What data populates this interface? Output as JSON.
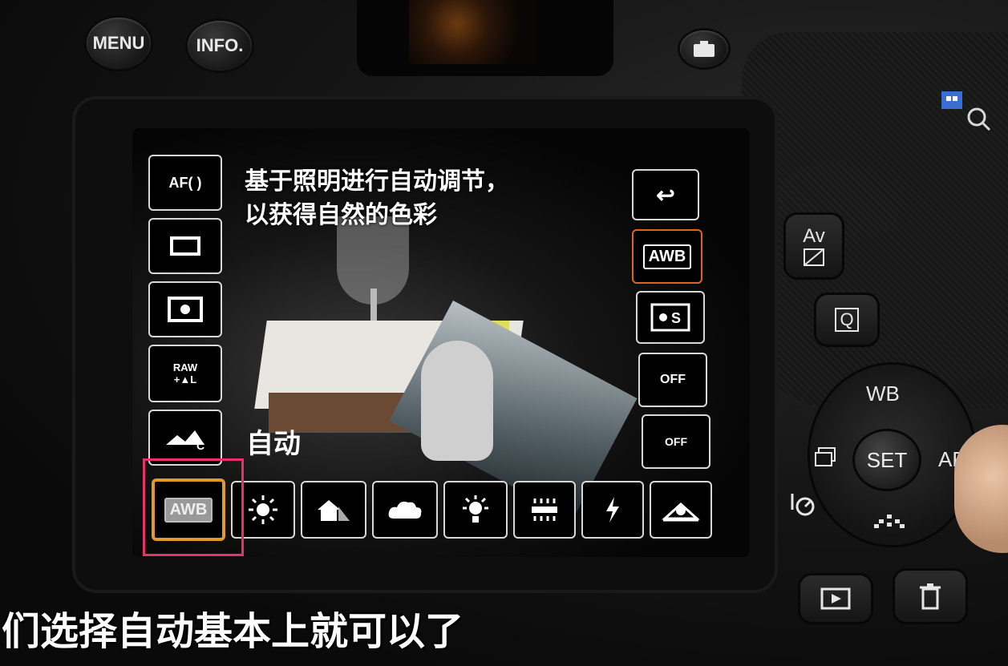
{
  "camera": {
    "menu_label": "MENU",
    "info_label": "INFO.",
    "wb_label": "WB",
    "set_label": "SET",
    "af_label": "AF",
    "av_label": "Av",
    "q_label": "Q"
  },
  "lcd": {
    "message_line1": "基于照明进行自动调节，",
    "message_line2": "以获得自然的色彩",
    "mode_label": "自动",
    "left_menu": [
      {
        "label": "AF( )",
        "icon": "af-area-icon"
      },
      {
        "label": "",
        "icon": "drive-mode-icon"
      },
      {
        "label": "",
        "icon": "metering-icon"
      },
      {
        "label": "RAW +▲L",
        "icon": "image-quality-icon"
      },
      {
        "label": "",
        "icon": "picture-style-icon"
      }
    ],
    "right_menu": [
      {
        "label": "↩",
        "icon": "return-icon"
      },
      {
        "label": "AWB",
        "icon": "awb-icon"
      },
      {
        "label": "",
        "icon": "wb-shift-icon"
      },
      {
        "label": "OFF",
        "icon": "auto-lighting-optimizer-icon"
      },
      {
        "label": "OFF",
        "icon": "peripheral-illumination-icon"
      }
    ],
    "wb_options": [
      {
        "label": "AWB",
        "icon": "awb-icon",
        "selected": true
      },
      {
        "label": "",
        "icon": "daylight-icon",
        "selected": false
      },
      {
        "label": "",
        "icon": "shade-icon",
        "selected": false
      },
      {
        "label": "",
        "icon": "cloudy-icon",
        "selected": false
      },
      {
        "label": "",
        "icon": "tungsten-icon",
        "selected": false
      },
      {
        "label": "",
        "icon": "fluorescent-icon",
        "selected": false
      },
      {
        "label": "",
        "icon": "flash-icon",
        "selected": false
      },
      {
        "label": "",
        "icon": "custom-wb-icon",
        "selected": false
      }
    ]
  },
  "subtitle": "们选择自动基本上就可以了",
  "colors": {
    "selected_border": "#e09a2a",
    "annotation_box": "#e8306a",
    "awb_active": "#e0651a"
  }
}
